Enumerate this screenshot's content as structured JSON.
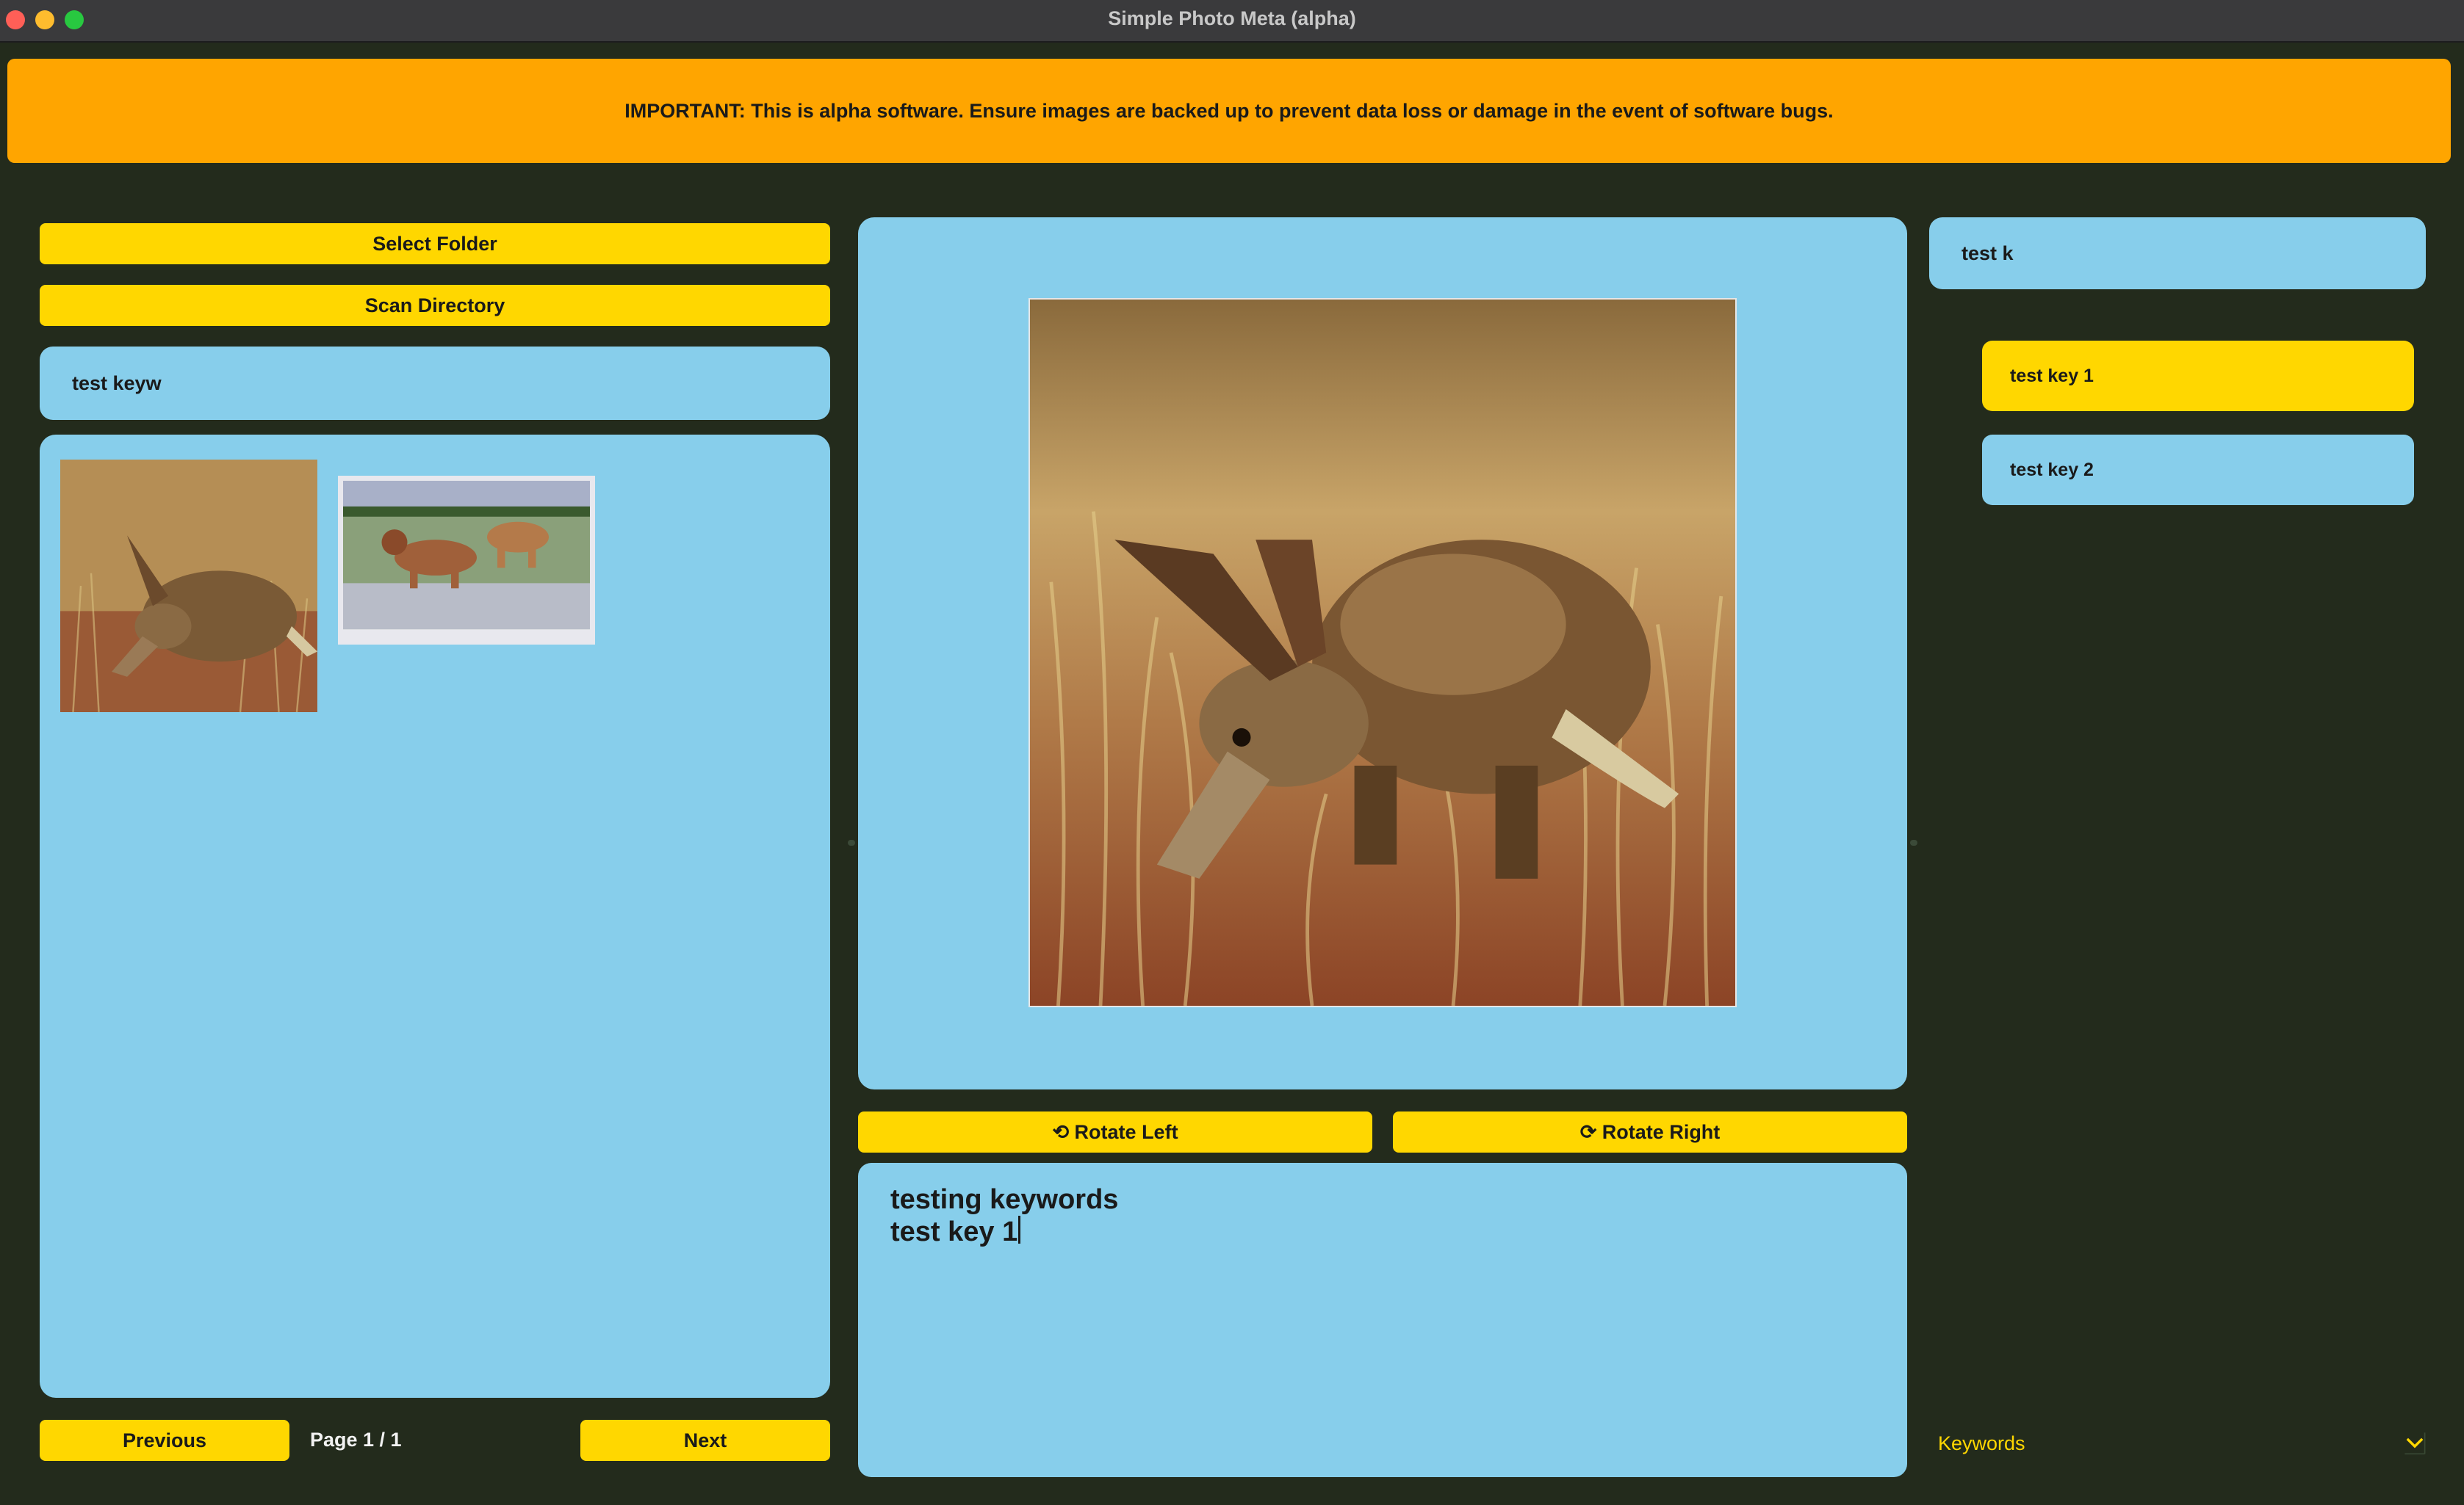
{
  "window": {
    "title": "Simple Photo Meta (alpha)"
  },
  "banner": {
    "text": "IMPORTANT: This is alpha software. Ensure images are backed up to prevent data loss or damage in the event of software bugs."
  },
  "left_panel": {
    "select_folder_label": "Select Folder",
    "scan_directory_label": "Scan Directory",
    "search_value": "test keyw",
    "thumbnails": [
      {
        "subject": "aardvark-photo"
      },
      {
        "subject": "dogs-photo"
      }
    ],
    "pagination": {
      "previous_label": "Previous",
      "page_text": "Page 1 / 1",
      "next_label": "Next"
    }
  },
  "center_panel": {
    "preview_subject": "aardvark-photo",
    "rotate_left_label": "⟲ Rotate Left",
    "rotate_right_label": "⟳ Rotate Right",
    "keyword_editor": {
      "lines": [
        "testing keywords",
        "test key 1"
      ]
    }
  },
  "right_panel": {
    "keyword_search_value": "test k",
    "suggestions": [
      {
        "label": "test key 1",
        "highlighted": true
      },
      {
        "label": "test key 2",
        "highlighted": false
      }
    ],
    "dropdown_label": "Keywords",
    "dropdown_icon": "chevron-down-icon"
  },
  "colors": {
    "background": "#232b1c",
    "banner": "#ffa500",
    "button": "#ffd700",
    "panel": "#87ceeb",
    "dropdown_text": "#ffd700"
  }
}
